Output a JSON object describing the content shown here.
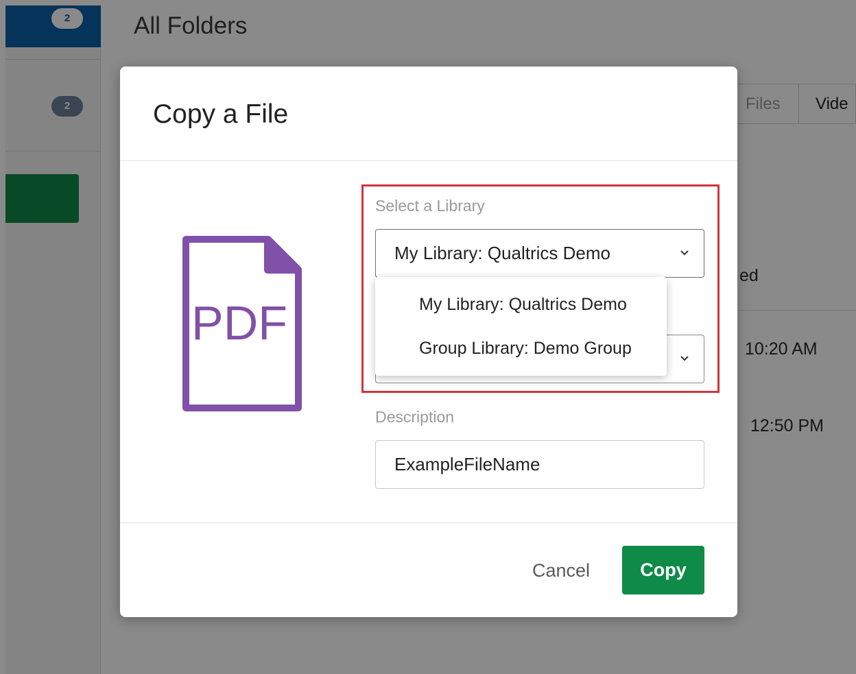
{
  "background": {
    "sidebar": {
      "badge_top": "2",
      "badge_second": "2"
    },
    "header_title": "All Folders",
    "tabs": [
      "Files",
      "Vide"
    ],
    "column_fragment": "ed",
    "times": [
      "10:20 AM",
      "12:50 PM"
    ]
  },
  "modal": {
    "title": "Copy a File",
    "file_icon_label": "PDF",
    "library_label": "Select a Library",
    "library_selected": "My Library: Qualtrics Demo",
    "library_options": [
      "My Library: Qualtrics Demo",
      "Group Library: Demo Group"
    ],
    "description_label": "Description",
    "description_value": "ExampleFileName",
    "cancel_label": "Cancel",
    "copy_label": "Copy"
  },
  "colors": {
    "accent_green": "#0f8a48",
    "sidebar_active_blue": "#0b5fa5",
    "pdf_purple": "#8150a8",
    "highlight_red": "#d1343d"
  }
}
